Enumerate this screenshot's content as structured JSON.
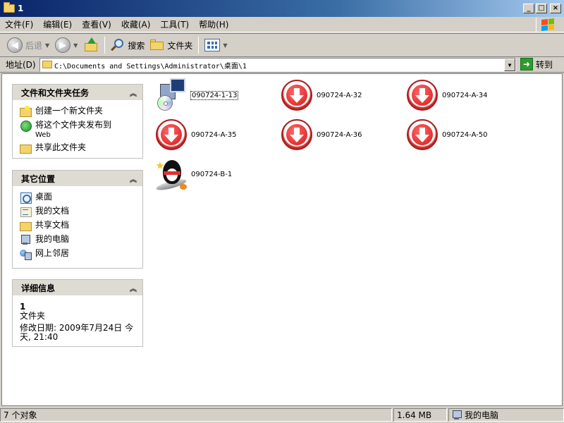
{
  "window": {
    "title": "1",
    "buttons": {
      "minimize": "_",
      "maximize": "□",
      "close": "×"
    }
  },
  "menu": [
    "文件(F)",
    "编辑(E)",
    "查看(V)",
    "收藏(A)",
    "工具(T)",
    "帮助(H)"
  ],
  "toolbar": {
    "back_label": "后退",
    "search_label": "搜索",
    "folders_label": "文件夹"
  },
  "address": {
    "label": "地址(D)",
    "path": "C:\\Documents and Settings\\Administrator\\桌面\\1",
    "go_label": "转到"
  },
  "panels": {
    "tasks": {
      "title": "文件和文件夹任务",
      "items": [
        "创建一个新文件夹",
        "将这个文件夹发布到",
        "Web",
        "共享此文件夹"
      ]
    },
    "places": {
      "title": "其它位置",
      "items": [
        "桌面",
        "我的文档",
        "共享文档",
        "我的电脑",
        "网上邻居"
      ]
    },
    "details": {
      "title": "详细信息",
      "name": "1",
      "type": "文件夹",
      "modified_line1": "修改日期: 2009年7月24日 今",
      "modified_line2": "天, 21:40"
    }
  },
  "files": [
    {
      "name": "090724-1-13",
      "icon": "setup-icon"
    },
    {
      "name": "090724-A-32",
      "icon": "download-arrow-icon"
    },
    {
      "name": "090724-A-34",
      "icon": "download-arrow-icon"
    },
    {
      "name": "090724-A-35",
      "icon": "download-arrow-icon"
    },
    {
      "name": "090724-A-36",
      "icon": "download-arrow-icon"
    },
    {
      "name": "090724-A-50",
      "icon": "download-arrow-icon"
    },
    {
      "name": "090724-B-1",
      "icon": "qq-penguin-icon"
    }
  ],
  "status": {
    "count": "7 个对象",
    "size": "1.64 MB",
    "location": "我的电脑"
  },
  "colors": {
    "titlebar_start": "#0a246a",
    "titlebar_end": "#a6caf0",
    "window_face": "#d4d0c8",
    "panel_header": "#dedbd3",
    "download_red": "#d81818"
  }
}
